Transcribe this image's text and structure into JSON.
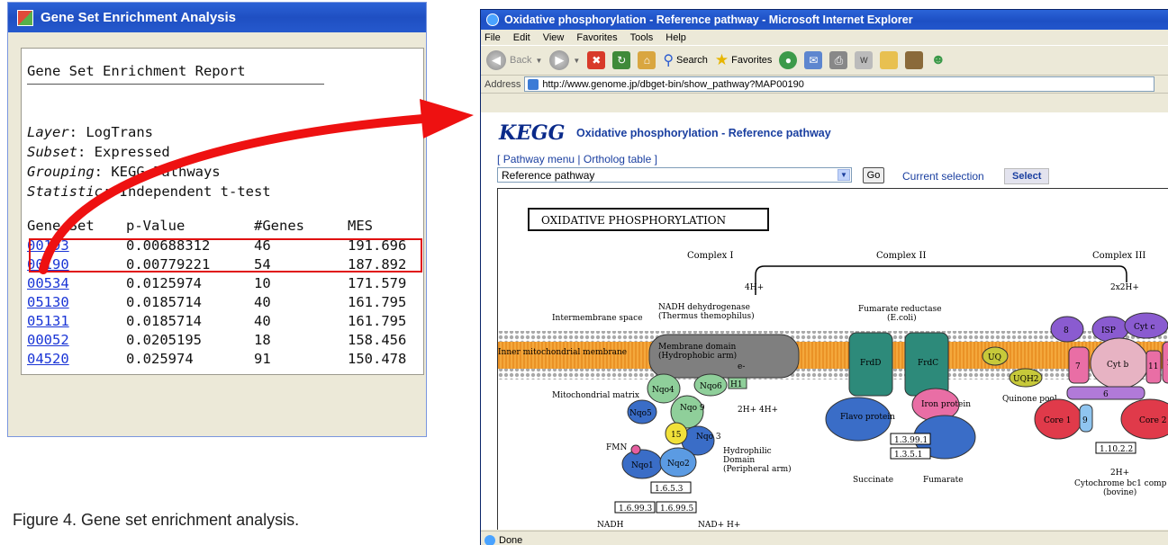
{
  "gsea_window": {
    "title": "Gene Set Enrichment Analysis",
    "report_title": "Gene Set Enrichment Report",
    "layer_label": "Layer",
    "layer_value": "LogTrans",
    "subset_label": "Subset",
    "subset_value": "Expressed",
    "grouping_label": "Grouping",
    "grouping_value": "KEGG Pathways",
    "statistic_label": "Statistic",
    "statistic_value": "Independent t-test",
    "columns": [
      "Gene Set",
      "p-Value",
      "#Genes",
      "MES"
    ],
    "rows": [
      [
        "00193",
        "0.00688312",
        "46",
        "191.696"
      ],
      [
        "00190",
        "0.00779221",
        "54",
        "187.892"
      ],
      [
        "00534",
        "0.0125974",
        "10",
        "171.579"
      ],
      [
        "05130",
        "0.0185714",
        "40",
        "161.795"
      ],
      [
        "05131",
        "0.0185714",
        "40",
        "161.795"
      ],
      [
        "00052",
        "0.0205195",
        "18",
        "158.456"
      ],
      [
        "04520",
        "0.025974",
        "91",
        "150.478"
      ]
    ]
  },
  "caption": "Figure 4. Gene set enrichment analysis.",
  "ie_window": {
    "title": "Oxidative phosphorylation - Reference pathway - Microsoft Internet Explorer",
    "menu": [
      "File",
      "Edit",
      "View",
      "Favorites",
      "Tools",
      "Help"
    ],
    "toolbar": {
      "back": "Back",
      "search": "Search",
      "favorites": "Favorites"
    },
    "address_label": "Address",
    "address_url": "http://www.genome.jp/dbget-bin/show_pathway?MAP00190",
    "status": "Done"
  },
  "kegg_page": {
    "logo": "KEGG",
    "heading": "Oxidative phosphorylation - Reference pathway",
    "link_open": "[",
    "link_pathway_menu": "Pathway menu",
    "link_sep": "|",
    "link_ortholog": "Ortholog table",
    "link_close": "]",
    "select_value": "Reference pathway",
    "go_label": "Go",
    "current_selection": "Current selection",
    "select_button": "Select"
  },
  "pathway_map": {
    "title": "OXIDATIVE PHOSPHORYLATION",
    "complex_1": "Complex I",
    "complex_2": "Complex II",
    "complex_3": "Complex III",
    "intermembrane": "Intermembrane space",
    "inner_membrane": "Inner mitochondrial membrane",
    "matrix": "Mitochondrial matrix",
    "nadh_dehydrogenase": "NADH dehydrogenase",
    "nadh_organism": "(Thermus themophilus)",
    "membrane_domain": "Membrane domain",
    "hydrophobic_arm": "(Hydrophobic arm)",
    "fumarate_reductase": "Fumarate reductase",
    "fumarate_organism": "(E.coli)",
    "hydrophilic": "Hydrophilic",
    "domain": "Domain",
    "peripheral_arm": "(Peripheral arm)",
    "fmn": "FMN",
    "nadh": "NADH",
    "nad_h": "NAD+ H+",
    "succinate": "Succinate",
    "fumarate": "Fumarate",
    "quinone_pool": "Quinone pool",
    "flavo_protein": "Flavo protein",
    "iron_protein": "Iron protein",
    "cytochrome_bc1": "Cytochrome bc1 comp",
    "bovine": "(bovine)",
    "proton_4h": "4H+",
    "proton_2x2h": "2x2H+",
    "proton_2h_4h": "2H+ 4H+",
    "proton_2h": "2H+",
    "e_minus": "e-",
    "ec": [
      "1.6.5.3",
      "1.6.99.3",
      "1.6.99.5",
      "1.3.99.1",
      "1.3.5.1",
      "1.10.2.2"
    ],
    "subunits": {
      "nqo1": "Nqo1",
      "nqo2": "Nqo2",
      "nqo3": "Nqo 3",
      "nqo4": "Nqo4",
      "nqo5": "Nqo5",
      "nqo6": "Nqo6",
      "nqo9": "Nqo 9",
      "n15": "15",
      "h1": "H1",
      "frdd": "FrdD",
      "frdc": "FrdC",
      "uq": "UQ",
      "uqh2": "UQH2",
      "isp": "ISP",
      "cytc": "Cyt c",
      "cytb": "Cyt b",
      "core1": "Core 1",
      "core2": "Core 2",
      "n7": "7",
      "n8": "8",
      "n6": "6",
      "n9": "9",
      "n10": "10",
      "n11": "11"
    }
  }
}
